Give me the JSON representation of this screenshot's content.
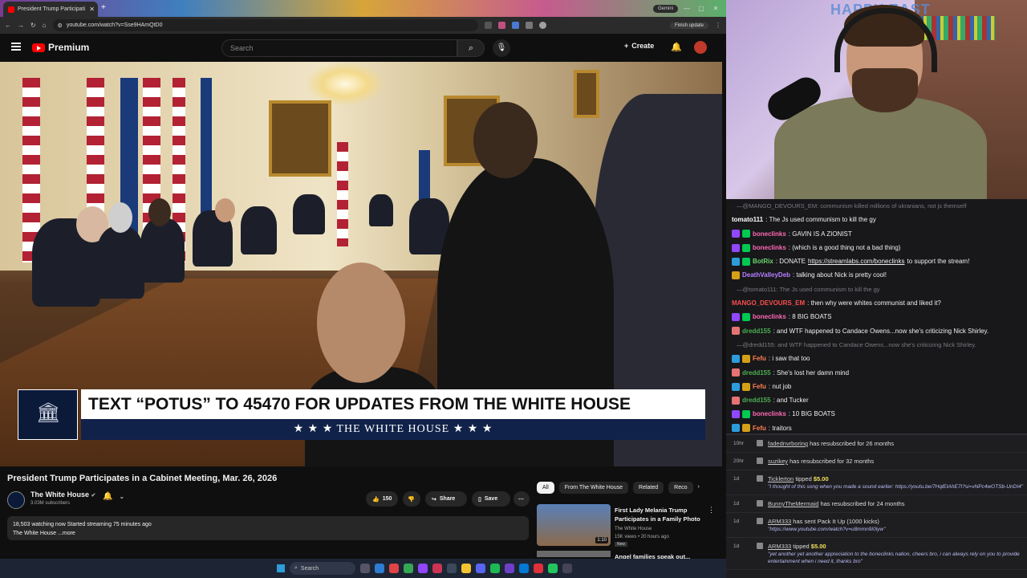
{
  "browser": {
    "tab_title": "President Trump Participati",
    "url": "youtube.com/watch?v=Sse9HAmQtD0",
    "gemini": "Gemini",
    "finish_update": "Finish update"
  },
  "youtube": {
    "brand": "Premium",
    "search_placeholder": "Search",
    "create": "Create",
    "video_title": "President Trump Participates in a Cabinet Meeting, Mar. 26, 2026",
    "channel": "The White House",
    "subscribers": "3.03M subscribers",
    "likes": "150",
    "share": "Share",
    "save": "Save",
    "description_line1": "18,503 watching now  Started streaming 75 minutes ago",
    "description_line2": "The White House ...more",
    "banner_text": "TEXT “POTUS” TO 45470 FOR UPDATES FROM THE WHITE HOUSE",
    "banner_sub": "★ ★ ★   THE WHITE HOUSE   ★ ★ ★",
    "chips": [
      "All",
      "From The White House",
      "Related",
      "Reco"
    ],
    "related": [
      {
        "title": "First Lady Melania Trump Participates in a Family Photo",
        "channel": "The White House",
        "meta": "15K views • 20 hours ago",
        "badge": "New",
        "duration": "1:10"
      },
      {
        "title": "Angel families speak out..."
      }
    ]
  },
  "taskbar": {
    "search": "Search"
  },
  "webcam": {
    "sign": "HAPPY EAST"
  },
  "chat": [
    {
      "type": "reply",
      "text": "—@MANGO_DEVOURS_EM: communism killed millions of ukranians, not js themself"
    },
    {
      "type": "msg",
      "user": "tomato111",
      "color": "#ffffff",
      "text": ": The Js used communism to kill the gy",
      "badges": []
    },
    {
      "type": "msg",
      "user": "boneclinks",
      "color": "#ff69b4",
      "text": ": GAVIN IS A ZIONIST",
      "badges": [
        "#9147ff",
        "#00c853"
      ]
    },
    {
      "type": "msg",
      "user": "boneclinks",
      "color": "#ff69b4",
      "text": ": (which is a good thing not a bad thing)",
      "badges": [
        "#9147ff",
        "#00c853"
      ]
    },
    {
      "type": "msg",
      "user": "BotRix",
      "color": "#6ad66a",
      "text": ": DONATE ",
      "link": "https://streamlabs.com/boneclinks",
      "after": " to support the stream!",
      "badges": [
        "#2d9cdb",
        "#00c853"
      ]
    },
    {
      "type": "msg",
      "user": "DeathValleyDeb",
      "color": "#b77fff",
      "text": ": talking about Nick is pretty cool!",
      "badges": [
        "#d4a017"
      ]
    },
    {
      "type": "reply",
      "text": "—@tomato111: The Js used communism to kill the gy"
    },
    {
      "type": "msg",
      "user": "MANGO_DEVOURS_EM",
      "color": "#ff4d4d",
      "text": ": then why were whites communist and liked it?",
      "badges": []
    },
    {
      "type": "msg",
      "user": "boneclinks",
      "color": "#ff69b4",
      "text": ": 8 BIG BOATS",
      "badges": [
        "#9147ff",
        "#00c853"
      ]
    },
    {
      "type": "msg",
      "user": "dredd155",
      "color": "#4caf50",
      "text": ": and WTF happened to Candace Owens...now she's criticizing Nick Shirley.",
      "badges": [
        "#e57373"
      ]
    },
    {
      "type": "reply",
      "text": "—@dredd155: and WTF happened to Candace Owens...now she's criticizing Nick Shirley."
    },
    {
      "type": "msg",
      "user": "Fefu",
      "color": "#ff7f50",
      "text": ": i saw that too",
      "badges": [
        "#2d9cdb",
        "#d4a017"
      ]
    },
    {
      "type": "msg",
      "user": "dredd155",
      "color": "#4caf50",
      "text": ": She's lost her damn mind",
      "badges": [
        "#e57373"
      ]
    },
    {
      "type": "msg",
      "user": "Fefu",
      "color": "#ff7f50",
      "text": ": nut job",
      "badges": [
        "#2d9cdb",
        "#d4a017"
      ]
    },
    {
      "type": "msg",
      "user": "dredd155",
      "color": "#4caf50",
      "text": ": and Tucker",
      "badges": [
        "#e57373"
      ]
    },
    {
      "type": "msg",
      "user": "boneclinks",
      "color": "#ff69b4",
      "text": ": 10 BIG BOATS",
      "badges": [
        "#9147ff",
        "#00c853"
      ]
    },
    {
      "type": "msg",
      "user": "Fefu",
      "color": "#ff7f50",
      "text": ": traitors",
      "badges": [
        "#2d9cdb",
        "#d4a017"
      ]
    }
  ],
  "feed": [
    {
      "age": "10hr",
      "name": "fadednvrboring",
      "text": " has resubscribed for 26 months"
    },
    {
      "age": "20hr",
      "name": "suzikey",
      "text": " has resubscribed for 32 months"
    },
    {
      "age": "1d",
      "name": "Ticklerton",
      "text": " tipped ",
      "amount": "$5.00",
      "note": "\"I thought of this song when you made a sound earlier: https://youtu.be/7HqlEtAhE7I?si=vNPc4wOTSb-UnDI4\""
    },
    {
      "age": "1d",
      "name": "BunnyTheMermaid",
      "text": " has resubscribed for 24 months"
    },
    {
      "age": "1d",
      "name": "ARM333",
      "text": " has sent Pack It Up (1000 kicks)",
      "note": "\"https://www.youtube.com/watch?v=u8mmn9I0iyw\""
    },
    {
      "age": "1d",
      "name": "ARM333",
      "text": " tipped ",
      "amount": "$5.00",
      "note": "\"yet another yet another appreciation to the boneclinks nation, cheers bro, i can always rely on you to provide entertainment when i need it, thanks bro\""
    }
  ]
}
